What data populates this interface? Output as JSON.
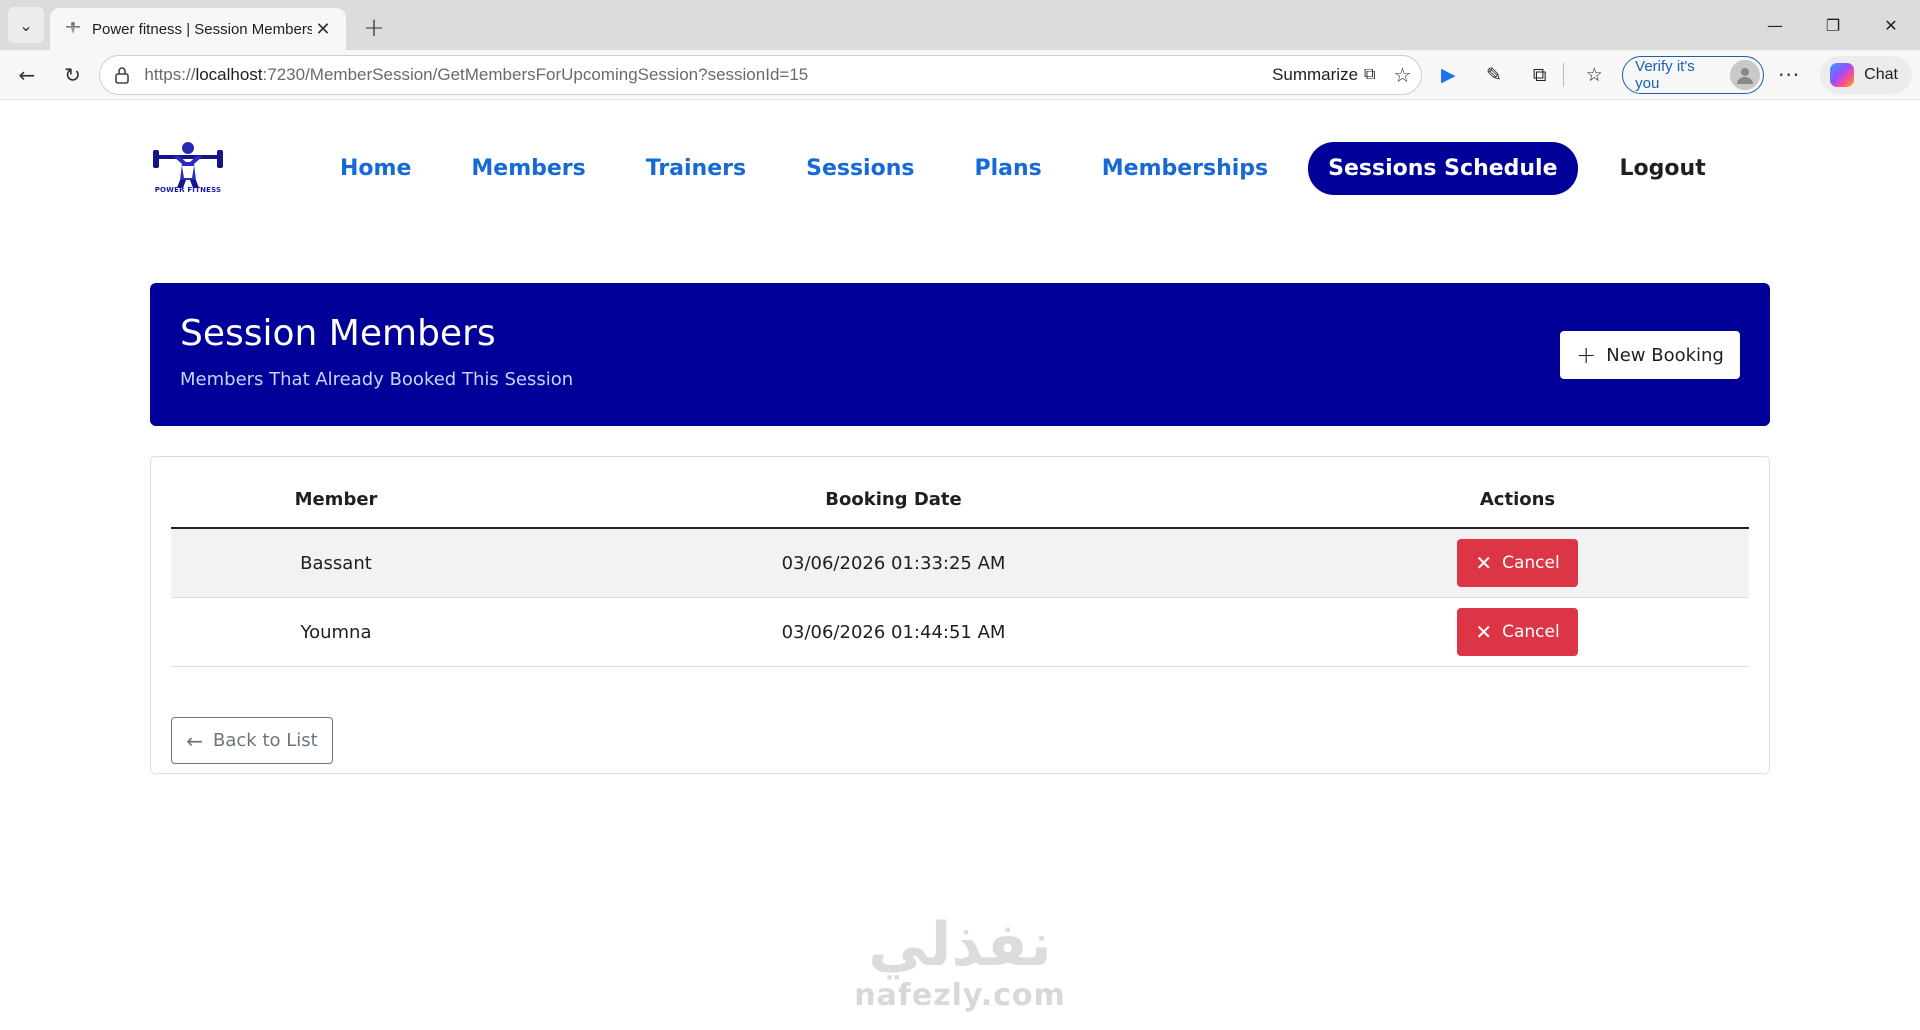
{
  "browser": {
    "tab_title": "Power fitness | Session Members",
    "url_prefix": "https://",
    "url_host": "localhost",
    "url_rest": ":7230/MemberSession/GetMembersForUpcomingSession?sessionId=15",
    "summarize_label": "Summarize",
    "verify_label": "Verify it's you",
    "chat_label": "Chat"
  },
  "site": {
    "logo_text": "POWER FITNESS",
    "nav": {
      "home": "Home",
      "members": "Members",
      "trainers": "Trainers",
      "sessions": "Sessions",
      "plans": "Plans",
      "memberships": "Memberships",
      "sessions_schedule": "Sessions Schedule",
      "logout": "Logout"
    },
    "active_nav": "Sessions Schedule"
  },
  "hero": {
    "title": "Session Members",
    "subtitle": "Members That Already Booked This Session",
    "new_booking_label": "New Booking"
  },
  "table": {
    "headers": [
      "Member",
      "Booking Date",
      "Actions"
    ],
    "rows": [
      {
        "member": "Bassant",
        "booking_date": "03/06/2026 01:33:25 AM",
        "action_label": "Cancel"
      },
      {
        "member": "Youmna",
        "booking_date": "03/06/2026 01:44:51 AM",
        "action_label": "Cancel"
      }
    ]
  },
  "back_label": "Back to List",
  "watermark": {
    "arabic": "نفذلي",
    "latin": "nafezly.com"
  },
  "colors": {
    "brand_navy": "#000099",
    "nav_link": "#1669d6",
    "danger": "#dc3545",
    "secondary": "#6c757d"
  }
}
